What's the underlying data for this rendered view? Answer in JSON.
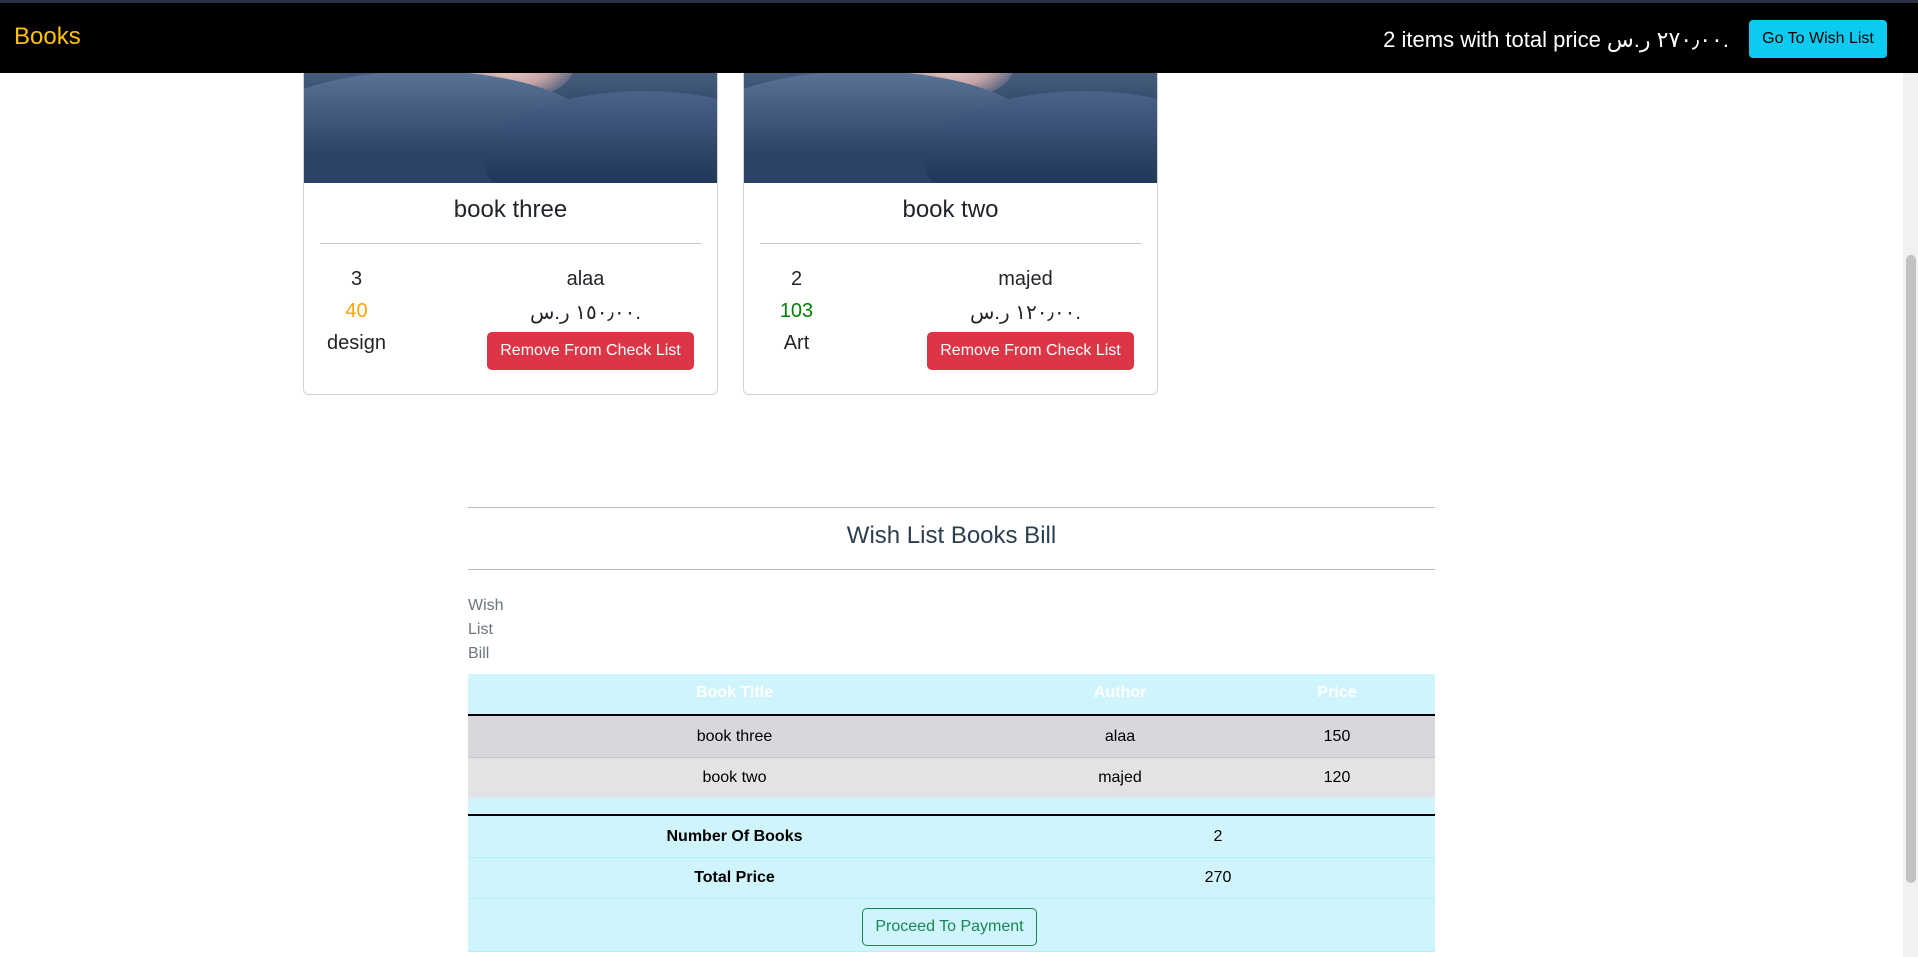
{
  "navbar": {
    "brand": "Books",
    "cart_summary": "2 items with total price ٢٧٠٫٠٠ ر.س.",
    "wish_button": "Go To Wish List"
  },
  "cards": [
    {
      "title": "book three",
      "quantity": "3",
      "author": "alaa",
      "stock": "40",
      "stock_color": "#ffa500",
      "price": "١٥٠٫٠٠ ر.س.",
      "category": "design",
      "remove_label": "Remove From Check List"
    },
    {
      "title": "book two",
      "quantity": "2",
      "author": "majed",
      "stock": "103",
      "stock_color": "#008000",
      "price": "١٢٠٫٠٠ ر.س.",
      "category": "Art",
      "remove_label": "Remove From Check List"
    }
  ],
  "bill": {
    "title": "Wish List Books Bill",
    "caption": "Wish List Bill",
    "headers": [
      "Book Title",
      "Author",
      "Price"
    ],
    "rows": [
      {
        "title": "book three",
        "author": "alaa",
        "price": "150"
      },
      {
        "title": "book two",
        "author": "majed",
        "price": "120"
      }
    ],
    "summary": {
      "books_label": "Number Of Books",
      "books_value": "2",
      "total_label": "Total Price",
      "total_value": "270",
      "pay_label": "Proceed To Payment"
    }
  }
}
